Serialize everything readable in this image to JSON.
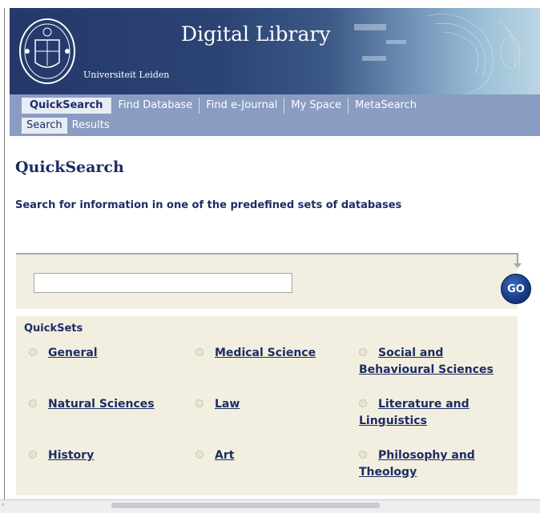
{
  "header": {
    "title": "Digital Library",
    "university": "Universiteit Leiden"
  },
  "nav": {
    "tabs": [
      {
        "label": "QuickSearch",
        "active": true
      },
      {
        "label": "Find Database",
        "active": false
      },
      {
        "label": "Find e-Journal",
        "active": false
      },
      {
        "label": "My Space",
        "active": false
      },
      {
        "label": "MetaSearch",
        "active": false
      }
    ],
    "subtabs": [
      {
        "label": "Search",
        "active": true
      },
      {
        "label": "Results",
        "active": false
      }
    ]
  },
  "main": {
    "page_title": "QuickSearch",
    "subtitle": "Search for information in one of the predefined sets of databases",
    "search": {
      "value": "",
      "go_label": "GO"
    },
    "quicksets": {
      "title": "QuickSets",
      "items": [
        {
          "label": "General"
        },
        {
          "label": "Medical Science"
        },
        {
          "label": "Social and Behavioural Sciences"
        },
        {
          "label": "Natural Sciences"
        },
        {
          "label": "Law"
        },
        {
          "label": "Literature and Linguistics"
        },
        {
          "label": "History"
        },
        {
          "label": "Art"
        },
        {
          "label": "Philosophy and Theology"
        }
      ]
    }
  },
  "colors": {
    "nav_bg": "#8a9cc2",
    "text_navy": "#1d2d63",
    "panel_bg": "#f2efe0"
  }
}
